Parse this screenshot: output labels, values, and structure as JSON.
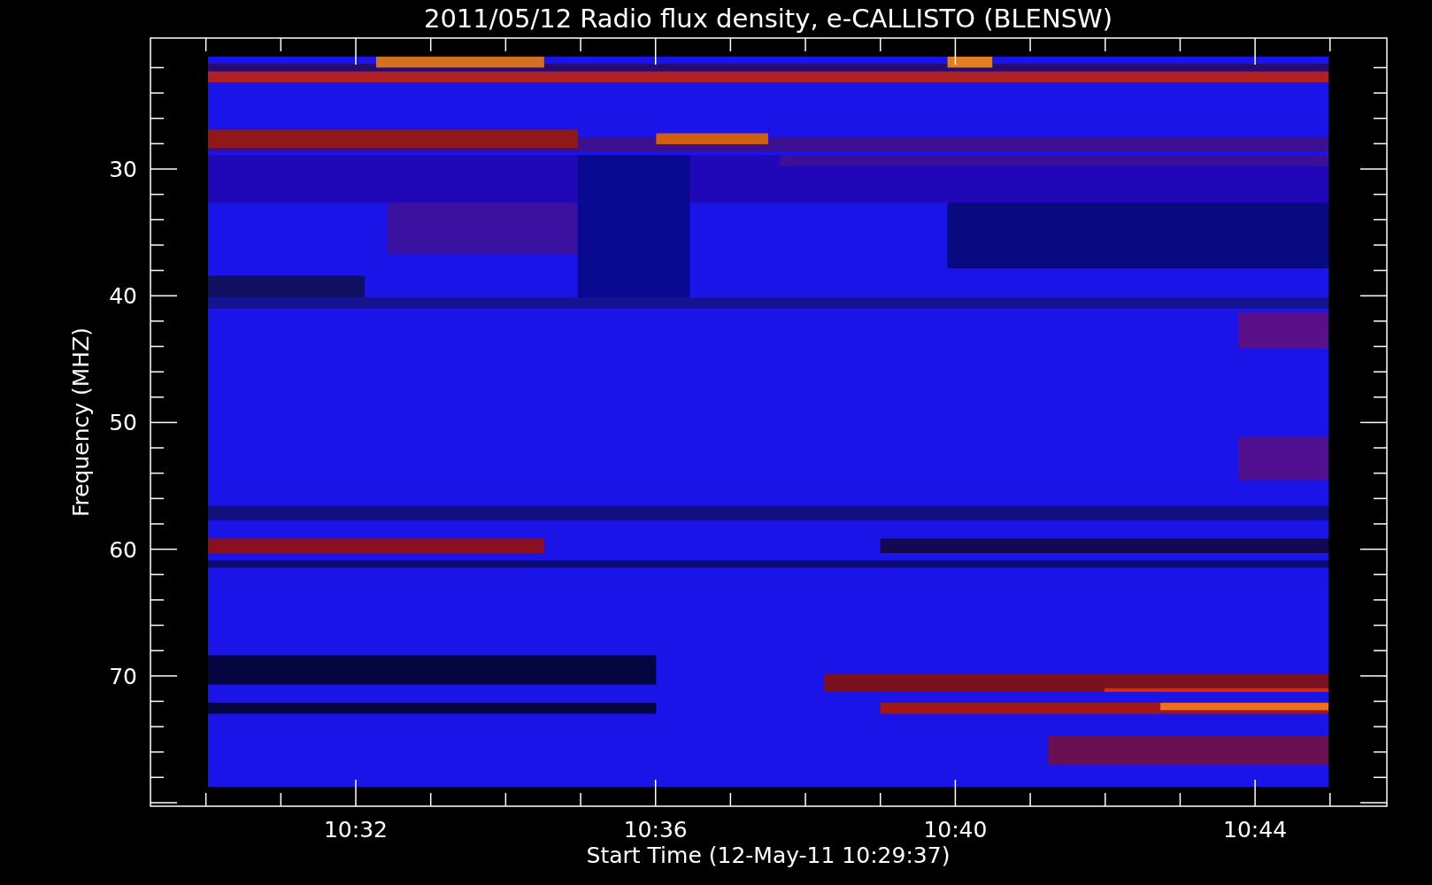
{
  "title": "2011/05/12  Radio flux density, e-CALLISTO (BLENSW)",
  "y_axis": {
    "label": "Frequency (MHZ)",
    "ticks": [
      "30",
      "40",
      "50",
      "60",
      "70"
    ]
  },
  "x_axis": {
    "label": "Start Time (12-May-11 10:29:37)",
    "ticks": [
      "10:32",
      "10:36",
      "10:40",
      "10:44"
    ]
  }
}
